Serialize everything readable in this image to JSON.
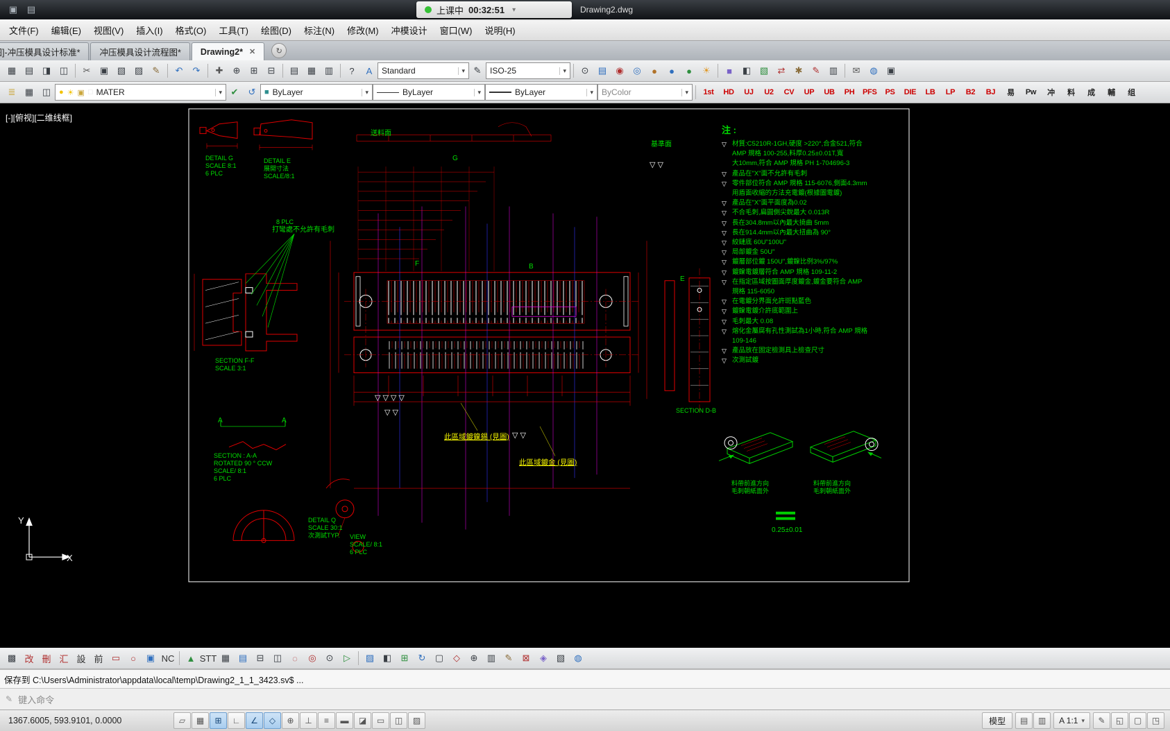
{
  "ui": {
    "caret": "▾"
  },
  "titlebar": {
    "icons": [
      {
        "name": "window-icon",
        "glyph": "▣"
      },
      {
        "name": "folder-icon",
        "glyph": "▤"
      }
    ],
    "timer": {
      "label": "上课中",
      "time": "00:32:51",
      "caret": "▾",
      "dot_color": "#35c135"
    },
    "doc_title": "Drawing2.dwg"
  },
  "menubar": {
    "items": [
      {
        "label": "文件(F)"
      },
      {
        "label": "编辑(E)"
      },
      {
        "label": "视图(V)"
      },
      {
        "label": "插入(I)"
      },
      {
        "label": "格式(O)"
      },
      {
        "label": "工具(T)"
      },
      {
        "label": "绘图(D)"
      },
      {
        "label": "标注(N)"
      },
      {
        "label": "修改(M)"
      },
      {
        "label": "冲模设计"
      },
      {
        "label": "窗口(W)"
      },
      {
        "label": "说明(H)"
      }
    ]
  },
  "tabbar": {
    "tabs": [
      {
        "label": "[图]-冲压模具设计标准*"
      },
      {
        "label": "冲压模具设计流程图*"
      },
      {
        "label": "Drawing2*",
        "active": true
      }
    ],
    "close_glyph": "✕",
    "overflow_glyph": "↻"
  },
  "toolbar_standard": {
    "file_group": [
      {
        "name": "save-icon",
        "glyph": "▦"
      },
      {
        "name": "plot-icon",
        "glyph": "▤"
      },
      {
        "name": "plot-preview-icon",
        "glyph": "◨"
      },
      {
        "name": "publish-icon",
        "glyph": "◫"
      }
    ],
    "edit_group": [
      {
        "name": "cut-icon",
        "glyph": "✂",
        "color": "#555555"
      },
      {
        "name": "copy-icon",
        "glyph": "▣"
      },
      {
        "name": "copy-base-icon",
        "glyph": "▧"
      },
      {
        "name": "paste-icon",
        "glyph": "▨"
      },
      {
        "name": "match-properties-icon",
        "glyph": "✎",
        "color": "#8a6d3b"
      }
    ],
    "undo_group": [
      {
        "name": "undo-icon",
        "glyph": "↶",
        "color": "#2f6fbe"
      },
      {
        "name": "redo-icon",
        "glyph": "↷",
        "color": "#2f6fbe"
      }
    ],
    "view_group": [
      {
        "name": "pan-icon",
        "glyph": "✚",
        "color": "#555555"
      },
      {
        "name": "zoom-realtime-icon",
        "glyph": "⊕"
      },
      {
        "name": "zoom-window-icon",
        "glyph": "⊞"
      },
      {
        "name": "zoom-previous-icon",
        "glyph": "⊟"
      }
    ],
    "palette_group": [
      {
        "name": "properties-icon",
        "glyph": "▤"
      },
      {
        "name": "designcenter-icon",
        "glyph": "▦"
      },
      {
        "name": "tool-palettes-icon",
        "glyph": "▥"
      }
    ],
    "misc_group": [
      {
        "name": "help-icon",
        "glyph": "?"
      },
      {
        "name": "text-style-icon",
        "glyph": "A",
        "color": "#2f6fbe"
      }
    ],
    "style_combo": {
      "value": "Standard"
    },
    "dim_brush": {
      "name": "dim-style-brush-icon",
      "glyph": "✎"
    },
    "dim_combo": {
      "value": "ISO-25"
    },
    "right_a": [
      {
        "name": "quickcalc-icon",
        "glyph": "⊙"
      },
      {
        "name": "sheet-set-icon",
        "glyph": "▤",
        "color": "#2f6fbe"
      },
      {
        "name": "markup-icon",
        "glyph": "◉",
        "color": "#b03030"
      },
      {
        "name": "orbit-icon",
        "glyph": "◎",
        "color": "#2f6fbe"
      },
      {
        "name": "materials-sphere-icon",
        "glyph": "●",
        "color": "#b0722a"
      },
      {
        "name": "render-sphere-icon",
        "glyph": "●",
        "color": "#2f6fbe"
      },
      {
        "name": "green-sphere-icon",
        "glyph": "●",
        "color": "#2f8f3f"
      },
      {
        "name": "sun-icon",
        "glyph": "☀",
        "color": "#e09b2d"
      }
    ],
    "right_b": [
      {
        "name": "cube-icon",
        "glyph": "■",
        "color": "#7a63c8"
      },
      {
        "name": "half-box-icon",
        "glyph": "◧"
      },
      {
        "name": "layers-panel-icon",
        "glyph": "▧",
        "color": "#2f8f3f"
      },
      {
        "name": "swap-arrows-icon",
        "glyph": "⇄",
        "color": "#b03030"
      },
      {
        "name": "tools-icon",
        "glyph": "✱",
        "color": "#8a6d3b"
      },
      {
        "name": "red-pen-icon",
        "glyph": "✎",
        "color": "#b03030"
      },
      {
        "name": "panel-icon",
        "glyph": "▥"
      }
    ],
    "right_c": [
      {
        "name": "mail-icon",
        "glyph": "✉",
        "color": "#555555"
      },
      {
        "name": "web-icon",
        "glyph": "◍",
        "color": "#2f6fbe"
      },
      {
        "name": "extra-icon",
        "glyph": "▣"
      }
    ]
  },
  "toolbar_layers": {
    "icons_left": [
      {
        "name": "layer-properties-icon",
        "glyph": "≣",
        "color": "#caa63c"
      },
      {
        "name": "layer-states-icon",
        "glyph": "▦"
      },
      {
        "name": "layer-isolate-icon",
        "glyph": "◫"
      }
    ],
    "layer_combo": {
      "status_glyph": "●",
      "status_color": "#f2c200",
      "freeze_glyph": "☀",
      "freeze_color": "#f2c200",
      "lock_glyph": "▣",
      "lock_color": "#caa63c",
      "swatch_glyph": "□",
      "swatch_color": "#dddddd",
      "value": "MATER"
    },
    "icons_mid": [
      {
        "name": "make-current-layer-icon",
        "glyph": "✔",
        "color": "#2f8f3f"
      },
      {
        "name": "layer-previous-icon",
        "glyph": "↺",
        "color": "#2f6fbe"
      }
    ],
    "color_combo": {
      "glyph": "■",
      "color": "#2f8f8f",
      "value": "ByLayer"
    },
    "linetype_combo": {
      "value": "ByLayer"
    },
    "lineweight_combo": {
      "value": "ByLayer"
    },
    "plotstyle_combo": {
      "value": "ByColor"
    },
    "quick_buttons": [
      {
        "label": "1st",
        "color": "#cc0000"
      },
      {
        "label": "HD",
        "color": "#cc0000"
      },
      {
        "label": "UJ",
        "color": "#cc0000"
      },
      {
        "label": "U2",
        "color": "#cc0000"
      },
      {
        "label": "CV",
        "color": "#cc0000"
      },
      {
        "label": "UP",
        "color": "#cc0000"
      },
      {
        "label": "UB",
        "color": "#cc0000"
      },
      {
        "label": "PH",
        "color": "#cc0000"
      },
      {
        "label": "PFS",
        "color": "#cc0000"
      },
      {
        "label": "PS",
        "color": "#cc0000"
      },
      {
        "label": "DIE",
        "color": "#cc0000"
      },
      {
        "label": "LB",
        "color": "#cc0000"
      },
      {
        "label": "LP",
        "color": "#cc0000"
      },
      {
        "label": "B2",
        "color": "#cc0000"
      },
      {
        "label": "BJ",
        "color": "#cc0000"
      },
      {
        "label": "易",
        "color": "#222222"
      },
      {
        "label": "Pw",
        "color": "#222222"
      },
      {
        "label": "冲",
        "color": "#222222"
      },
      {
        "label": "料",
        "color": "#222222"
      },
      {
        "label": "成",
        "color": "#222222"
      },
      {
        "label": "輔",
        "color": "#222222"
      },
      {
        "label": "组",
        "color": "#222222"
      }
    ]
  },
  "drawing": {
    "viewport_label": "[-][俯视][二维线框]",
    "ucs": {
      "x": "X",
      "y": "Y"
    },
    "notes_title": "注 :",
    "notes": [
      {
        "b": "▽",
        "t": "材質:C5210R-1GH,硬度 >220°,合金521,符合"
      },
      {
        "b": "",
        "t": "AMP 規格 100-255,料厚0.25±0.01T,寬"
      },
      {
        "b": "",
        "t": "大10mm,符合 AMP 規格 PH 1-704696-3"
      },
      {
        "b": "▽",
        "t": "產品在\"X\"面不允許有毛刺"
      },
      {
        "b": "▽",
        "t": "零件部位符合 AMP 規格 115-6076,側面4.3mm"
      },
      {
        "b": "",
        "t": "用盾面收縮的方法充電鍍(根據圖電鍍)"
      },
      {
        "b": "▽",
        "t": "產品在\"X\"面平面度為0.02"
      },
      {
        "b": "▽",
        "t": "不合毛刺,扁圓側尖銳最大 0.013R"
      },
      {
        "b": "▽",
        "t": "長在304.8mm以內最大撓曲 5mm"
      },
      {
        "b": "▽",
        "t": "長在914.4mm以內最大扭曲為 90°"
      },
      {
        "b": "▽",
        "t": "絞鏈底 60U\"100U\""
      },
      {
        "b": "▽",
        "t": "局部鍍金 50U\""
      },
      {
        "b": "▽",
        "t": "鍍層部位鍍 150U\",鍍鎳比例3%/97%"
      },
      {
        "b": "▽",
        "t": "鍍鎳電鍍層符合 AMP 規格 109-11-2"
      },
      {
        "b": "▽",
        "t": "在指定區域按圖面厚度鍍金,鍍金要符合 AMP"
      },
      {
        "b": "",
        "t": "規格 115-6050"
      },
      {
        "b": "▽",
        "t": "在電鍍分界面允許斑點藍色"
      },
      {
        "b": "▽",
        "t": "鍍鎳電鍍介許底範圍上"
      },
      {
        "b": "▽",
        "t": "毛刺最大 0.08"
      },
      {
        "b": "▽",
        "t": "熔化金屬腐有孔性測試為1小時,符合 AMP 規格"
      },
      {
        "b": "",
        "t": "109-146"
      },
      {
        "b": "▽",
        "t": "產品放在固定檢測具上檢查尺寸"
      },
      {
        "b": "▽",
        "t": "次測試鍍"
      }
    ],
    "labels": {
      "detail_g": [
        "DETAIL G",
        "SCALE 8:1",
        "6 PLC"
      ],
      "detail_e": [
        "DETAIL E",
        "展開寸法",
        "SCALE/8:1"
      ],
      "feed_note": "送料面",
      "datum_note": "基準面",
      "bend_qty": "8 PLC",
      "bend_note": "打彎處不允許有毛刺",
      "section_ff": [
        "SECTION  F-F",
        "SCALE  3:1"
      ],
      "section_aa": [
        "SECTION : A-A",
        "ROTATED 90 ° CCW",
        "SCALE/ 8:1",
        "6 PLC"
      ],
      "detail_q": [
        "DETAIL Q",
        "SCALE 30:1",
        "次測試TYP."
      ],
      "view": [
        "VIEW",
        "SCALE/ 8:1",
        "6 PLC"
      ],
      "plating_note_1": "此區域鍍鎳錫 (見圖)",
      "plating_note_2": "此區域鍍金 (見圖)",
      "section_db": "SECTION  D-B",
      "iso1": [
        "料帶前進方向",
        "毛刺朝紙面外"
      ],
      "iso2": [
        "料帶前進方向",
        "毛刺朝紙面外"
      ],
      "thickness": "0.25±0.01",
      "letters": {
        "g": "G",
        "f": "F",
        "b": "B",
        "e": "E",
        "a1": "A",
        "a2": "A"
      }
    },
    "triangles": {
      "row1": "▽▽▽▽",
      "row2": "▽▽",
      "row3": "▽▽",
      "datum": "▽▽"
    }
  },
  "toolbar_bottom": {
    "g1": [
      {
        "name": "panel-toggle-icon",
        "glyph": "▩"
      },
      {
        "name": "modify-cn-button",
        "glyph": "改",
        "color": "#b03030"
      },
      {
        "name": "delete-cn-button",
        "glyph": "刪",
        "color": "#b03030"
      },
      {
        "name": "collect-cn-button",
        "glyph": "汇",
        "color": "#b03030"
      },
      {
        "name": "design-cn-button",
        "glyph": "設",
        "color": "#333333"
      },
      {
        "name": "forward-cn-button",
        "glyph": "前",
        "color": "#333333"
      },
      {
        "name": "rectangle-tool-icon",
        "glyph": "▭",
        "color": "#b03030"
      },
      {
        "name": "circle-tool-icon",
        "glyph": "○",
        "color": "#b03030"
      },
      {
        "name": "block-tool-icon",
        "glyph": "▣",
        "color": "#2f6fbe"
      },
      {
        "name": "nc-button",
        "glyph": "NC",
        "color": "#333333"
      }
    ],
    "g2": [
      {
        "name": "triangle-tool-icon",
        "glyph": "▲",
        "color": "#2f8f3f"
      },
      {
        "name": "stt-button",
        "glyph": "STT",
        "color": "#333333"
      },
      {
        "name": "table-tool-icon",
        "glyph": "▦"
      },
      {
        "name": "print-small-icon",
        "glyph": "▤",
        "color": "#2f6fbe"
      },
      {
        "name": "minus-box-icon",
        "glyph": "⊟"
      },
      {
        "name": "split-box-icon",
        "glyph": "◫"
      },
      {
        "name": "ellipse-tool-icon",
        "glyph": "◌",
        "color": "#b03030"
      },
      {
        "name": "donut-tool-icon",
        "glyph": "◎",
        "color": "#b03030"
      },
      {
        "name": "point-tool-icon",
        "glyph": "⊙"
      },
      {
        "name": "play-tool-icon",
        "glyph": "▷",
        "color": "#2f8f3f"
      }
    ],
    "g3": [
      {
        "name": "hatch-tool-icon",
        "glyph": "▨",
        "color": "#2f6fbe"
      },
      {
        "name": "gradient-tool-icon",
        "glyph": "◧"
      },
      {
        "name": "plus-box-icon",
        "glyph": "⊞",
        "color": "#2f8f3f"
      },
      {
        "name": "rotate-tool-icon",
        "glyph": "↻",
        "color": "#2f6fbe"
      },
      {
        "name": "box-tool-icon",
        "glyph": "▢"
      },
      {
        "name": "diamond-tool-icon",
        "glyph": "◇",
        "color": "#b03030"
      },
      {
        "name": "zoom-plus-icon",
        "glyph": "⊕"
      },
      {
        "name": "rows-tool-icon",
        "glyph": "▥"
      },
      {
        "name": "pencil-tool-icon",
        "glyph": "✎",
        "color": "#8a6d3b"
      },
      {
        "name": "close-box-icon",
        "glyph": "⊠",
        "color": "#b03030"
      },
      {
        "name": "gem-tool-icon",
        "glyph": "◈",
        "color": "#7a63c8"
      },
      {
        "name": "pattern-tool-icon",
        "glyph": "▧"
      },
      {
        "name": "sphere-tool-icon",
        "glyph": "◍",
        "color": "#2f6fbe"
      }
    ]
  },
  "command": {
    "message": "保存到 C:\\Users\\Administrator\\appdata\\local\\temp\\Drawing2_1_1_3423.sv$ ...",
    "prompt_icon": "✎",
    "prompt": "键入命令"
  },
  "statusbar": {
    "coords": "1367.6005, 593.9101, 0.0000",
    "toggles": [
      {
        "name": "infer-constraints-toggle",
        "glyph": "▱"
      },
      {
        "name": "snap-toggle",
        "glyph": "▦"
      },
      {
        "name": "grid-toggle",
        "glyph": "⊞",
        "active": true
      },
      {
        "name": "ortho-toggle",
        "glyph": "∟"
      },
      {
        "name": "polar-toggle",
        "glyph": "∠",
        "active": true
      },
      {
        "name": "osnap-toggle",
        "glyph": "◇",
        "active": true
      },
      {
        "name": "otrack-toggle",
        "glyph": "⊕"
      },
      {
        "name": "ducs-toggle",
        "glyph": "⊥"
      },
      {
        "name": "dyn-toggle",
        "glyph": "≡"
      },
      {
        "name": "lineweight-toggle",
        "glyph": "▬"
      },
      {
        "name": "transparency-toggle",
        "glyph": "◪"
      },
      {
        "name": "quick-properties-toggle",
        "glyph": "▭"
      },
      {
        "name": "selection-cycling-toggle",
        "glyph": "◫"
      },
      {
        "name": "annotation-monitor-toggle",
        "glyph": "▨"
      }
    ],
    "model_label": "模型",
    "icons_a": [
      {
        "name": "layout-icon",
        "glyph": "▤"
      },
      {
        "name": "layout2-icon",
        "glyph": "▥"
      }
    ],
    "annotation_scale": "A 1:1",
    "icons_b": [
      {
        "name": "annotation-visibility-icon",
        "glyph": "✎"
      },
      {
        "name": "workspace-icon",
        "glyph": "◱"
      },
      {
        "name": "clean-screen-icon",
        "glyph": "▢"
      },
      {
        "name": "lock-ui-icon",
        "glyph": "◳"
      }
    ]
  }
}
